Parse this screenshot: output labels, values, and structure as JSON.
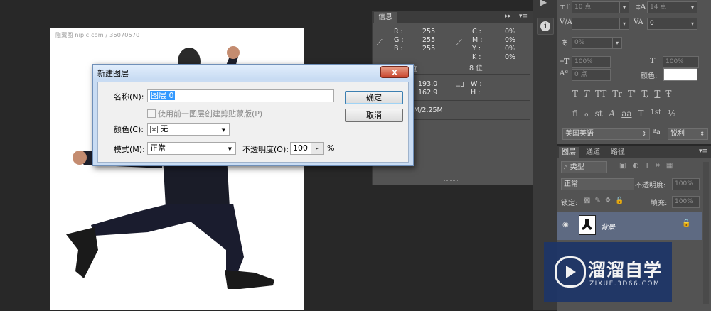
{
  "canvas": {
    "watermark": "隐藏图 nipic.com / 36070570"
  },
  "info_panel": {
    "tab": "信息",
    "r_label": "R :",
    "r_value": "255",
    "g_label": "G :",
    "g_value": "255",
    "b_label": "B :",
    "b_value": "255",
    "c_label": "C :",
    "c_value": "0%",
    "m_label": "M :",
    "m_value": "0%",
    "y_label": "Y :",
    "y_value": "0%",
    "k_label": "K :",
    "k_value": "0%",
    "bit_left": "8 位",
    "bit_right": "8 位",
    "x_value": "193.0",
    "y2_value": "162.9",
    "w_label": "W :",
    "h_label": "H :",
    "doc_size": "M/2.25M"
  },
  "character_panel": {
    "font_size": "10 点",
    "leading": "14 点",
    "kerning": "",
    "tracking": "0",
    "vscale": "0%",
    "vert_scale": "100%",
    "horiz_scale": "100%",
    "baseline": "0 点",
    "color_label": "颜色:",
    "type_buttons": [
      "T",
      "T",
      "TT",
      "Tr",
      "T'",
      "T,",
      "T",
      "Ŧ"
    ],
    "ot_buttons": [
      "fi",
      "ℴ",
      "st",
      "A",
      "aa",
      "T",
      "1st",
      "½"
    ],
    "language": "美国英语",
    "aa_label": "a",
    "antialias": "锐利"
  },
  "layers_panel": {
    "tabs": [
      "图层",
      "通道",
      "路径"
    ],
    "filter": "类型",
    "blend_mode": "正常",
    "opacity_label": "不透明度:",
    "opacity_value": "100%",
    "lock_label": "锁定:",
    "fill_label": "填充:",
    "fill_value": "100%",
    "layer_name": "背景"
  },
  "dialog": {
    "title": "新建图层",
    "close": "x",
    "name_label": "名称(N):",
    "name_value": "图层 0",
    "clip_label": "使用前一图层创建剪贴蒙版(P)",
    "color_label": "颜色(C):",
    "color_value": "无",
    "mode_label": "模式(M):",
    "mode_value": "正常",
    "opacity_label": "不透明度(O):",
    "opacity_value": "100",
    "percent": "%",
    "ok": "确定",
    "cancel": "取消"
  },
  "logo": {
    "name": "溜溜自学",
    "url": "ZIXUE.3D66.COM"
  }
}
